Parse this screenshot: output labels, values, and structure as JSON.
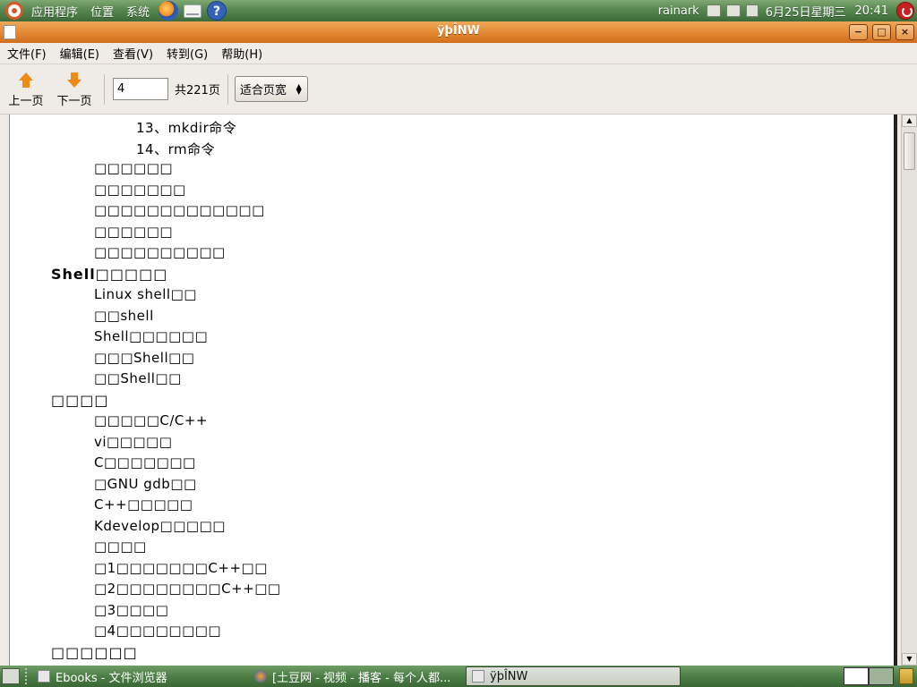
{
  "top_panel": {
    "menus": [
      "应用程序",
      "位置",
      "系统"
    ],
    "launchers": [
      "firefox-icon",
      "mail-icon",
      "help-icon"
    ],
    "help_glyph": "?",
    "user": "rainark",
    "date": "6月25日星期三",
    "time": "20:41"
  },
  "window": {
    "title": "ÿþÎNW",
    "controls": {
      "minimize": "−",
      "maximize": "□",
      "close": "×"
    }
  },
  "menubar": [
    "文件(F)",
    "编辑(E)",
    "查看(V)",
    "转到(G)",
    "帮助(H)"
  ],
  "toolbar": {
    "prev_label": "上一页",
    "next_label": "下一页",
    "page_value": "4",
    "page_total": "共221页",
    "zoom_value": "适合页宽",
    "zoom_spin": "▲\n▼"
  },
  "document": {
    "lines": [
      {
        "indent": 2,
        "text": "13、mkdir命令"
      },
      {
        "indent": 2,
        "text": "14、rm命令"
      },
      {
        "indent": 1,
        "text": "□□□□□□"
      },
      {
        "indent": 1,
        "text": "□□□□□□□"
      },
      {
        "indent": 1,
        "text": "□□□□□□□□□□□□□"
      },
      {
        "indent": 1,
        "text": "□□□□□□"
      },
      {
        "indent": 1,
        "text": "□□□□□□□□□□"
      },
      {
        "indent": 0,
        "text": "Shell□□□□□",
        "heading": true
      },
      {
        "indent": 1,
        "text": "Linux shell□□"
      },
      {
        "indent": 1,
        "text": "□□shell"
      },
      {
        "indent": 1,
        "text": "Shell□□□□□□"
      },
      {
        "indent": 1,
        "text": "□□□Shell□□"
      },
      {
        "indent": 1,
        "text": "□□Shell□□"
      },
      {
        "indent": 0,
        "text": "□□□□",
        "heading": true
      },
      {
        "indent": 1,
        "text": "□□□□□C/C++"
      },
      {
        "indent": 1,
        "text": "vi□□□□□"
      },
      {
        "indent": 1,
        "text": "C□□□□□□□"
      },
      {
        "indent": 1,
        "text": "□GNU gdb□□"
      },
      {
        "indent": 1,
        "text": "C++□□□□□"
      },
      {
        "indent": 1,
        "text": "Kdevelop□□□□□"
      },
      {
        "indent": 1,
        "text": "□□□□"
      },
      {
        "indent": 1,
        "text": "□1□□□□□□□C++□□"
      },
      {
        "indent": 1,
        "text": "□2□□□□□□□□C++□□"
      },
      {
        "indent": 1,
        "text": "□3□□□□"
      },
      {
        "indent": 1,
        "text": "□4□□□□□□□□"
      },
      {
        "indent": 0,
        "text": "□□□□□□",
        "heading": true
      }
    ]
  },
  "taskbar": {
    "tasks": [
      {
        "label": "Ebooks - 文件浏览器",
        "icon": "file-manager-icon",
        "active": false
      },
      {
        "label": "[土豆网 - 视频 - 播客 - 每个人都...",
        "icon": "firefox-icon",
        "active": false
      },
      {
        "label": "ÿþÎNW",
        "icon": "document-icon",
        "active": true
      }
    ]
  }
}
